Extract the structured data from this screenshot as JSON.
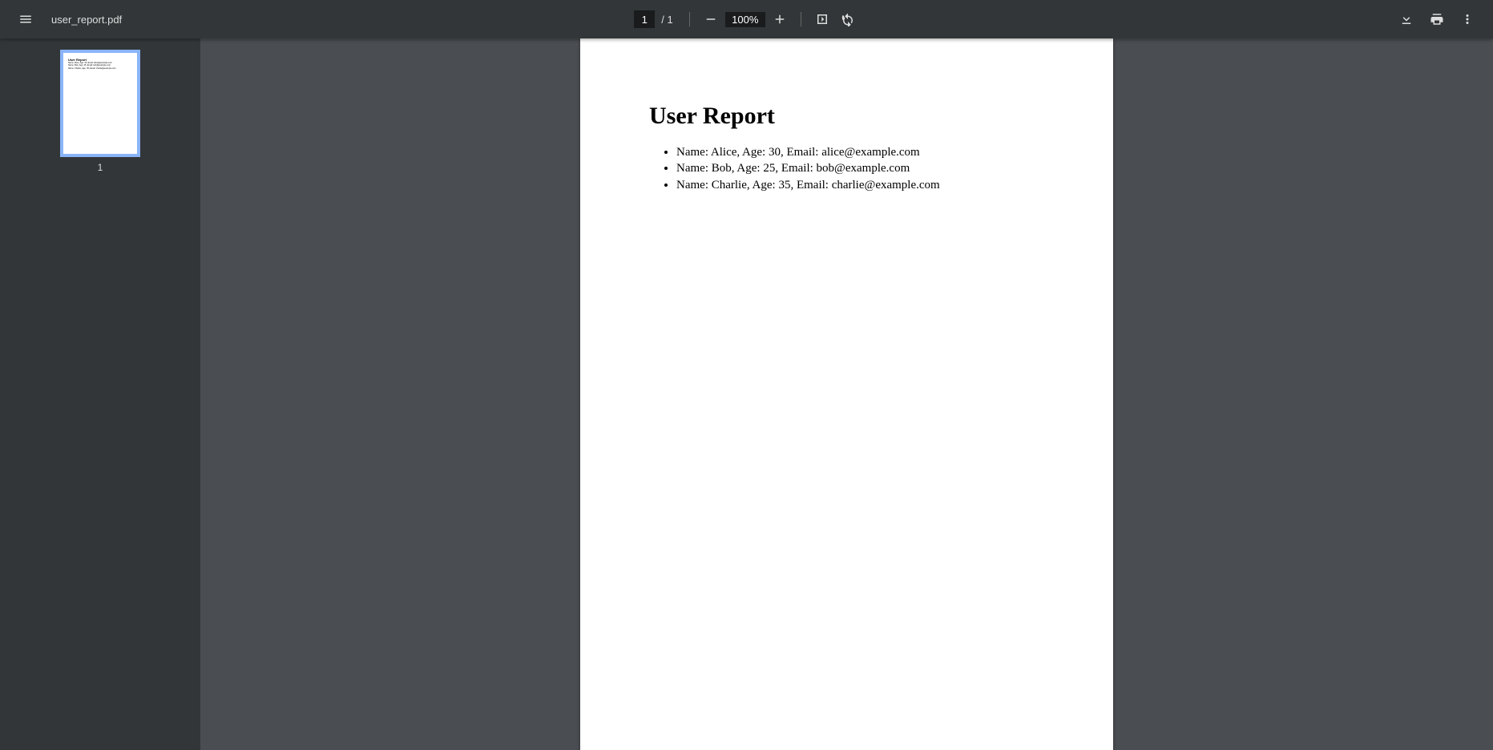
{
  "toolbar": {
    "filename": "user_report.pdf",
    "page_current": "1",
    "page_separator": "/",
    "page_total": "1",
    "zoom": "100%"
  },
  "sidebar": {
    "thumbnails": [
      {
        "number": "1"
      }
    ]
  },
  "document": {
    "title": "User Report",
    "entries": [
      "Name: Alice, Age: 30, Email: alice@example.com",
      "Name: Bob, Age: 25, Email: bob@example.com",
      "Name: Charlie, Age: 35, Email: charlie@example.com"
    ]
  }
}
